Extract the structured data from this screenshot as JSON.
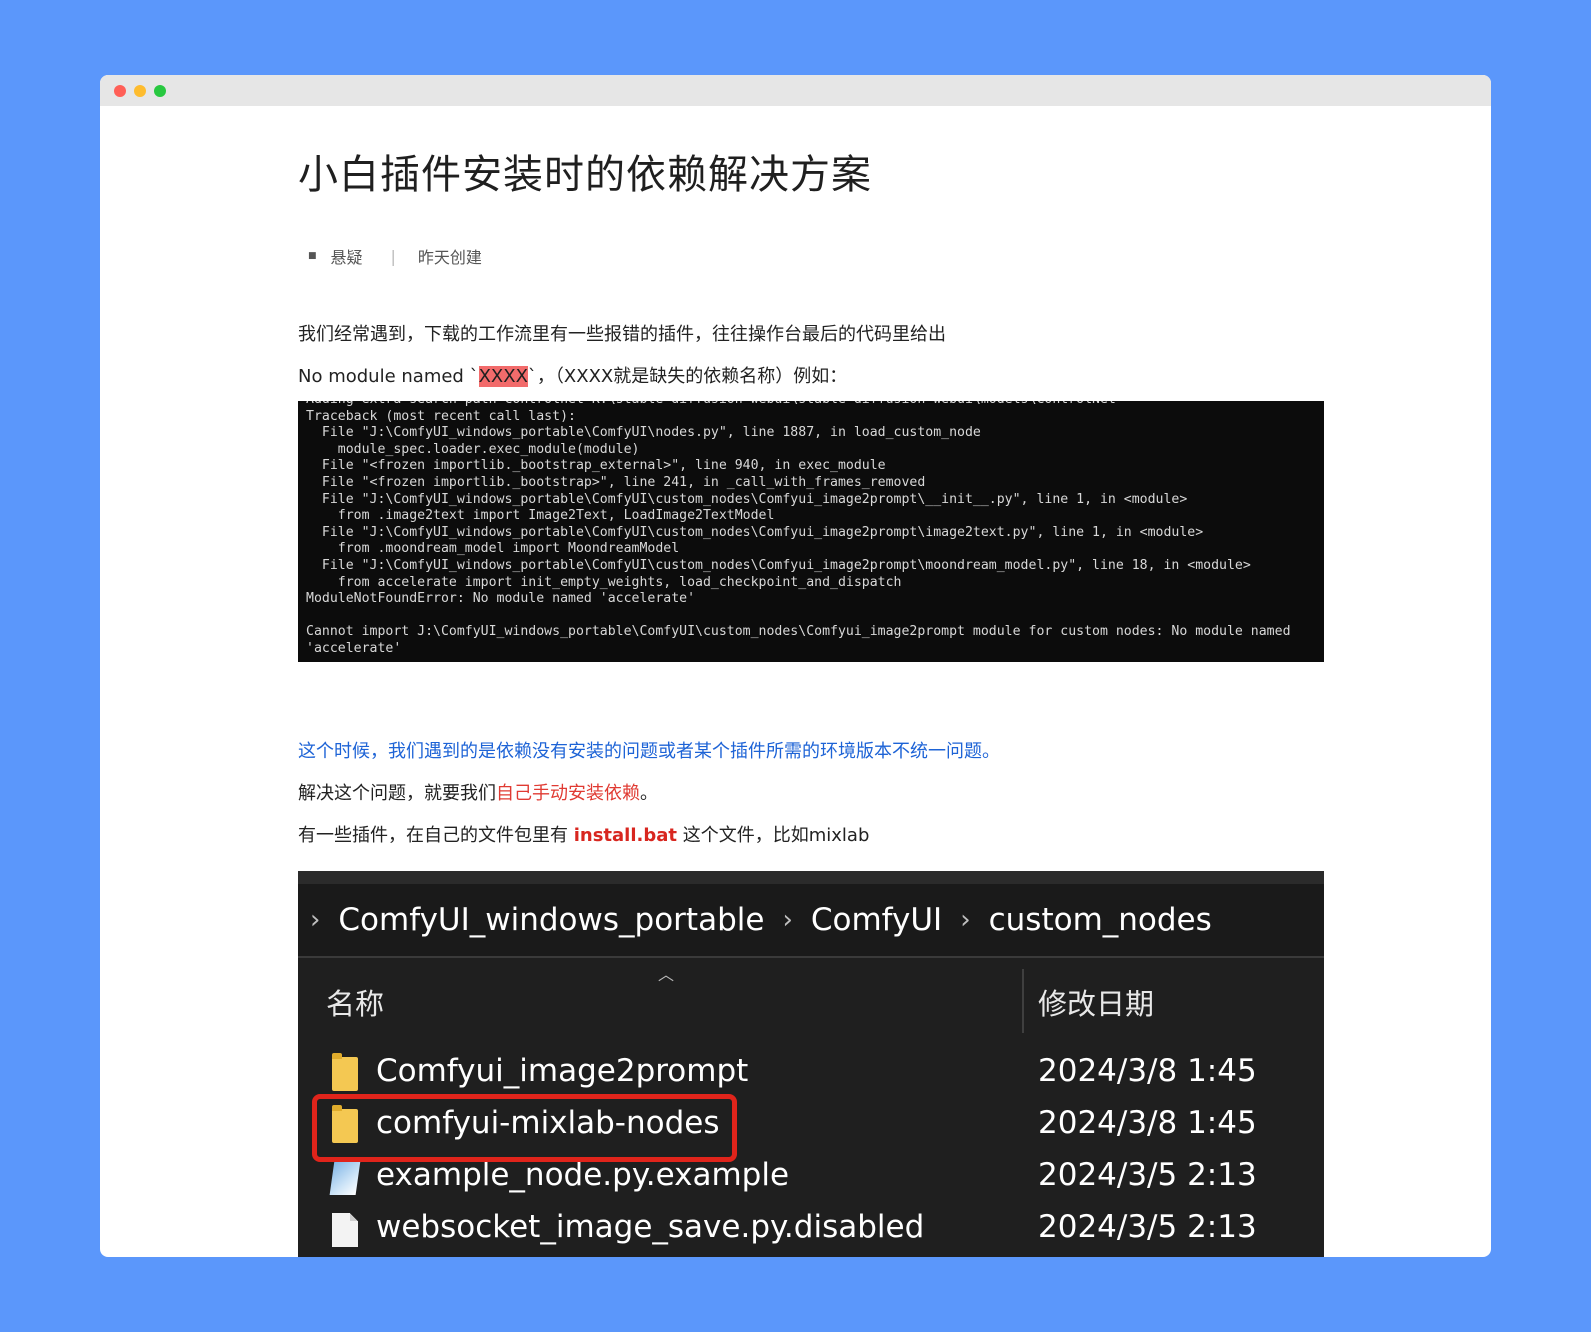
{
  "doc": {
    "title": "小白插件安装时的依赖解决方案",
    "meta": {
      "author": "悬疑",
      "created": "昨天创建"
    },
    "intro": "我们经常遇到，下载的工作流里有一些报错的插件，往往操作台最后的代码里给出",
    "module_line": {
      "prefix": "No module named `",
      "highlight": "XXXX",
      "suffix": "`，（XXXX就是缺失的依赖名称）例如："
    },
    "blue_line": "这个时候，我们遇到的是依赖没有安装的问题或者某个插件所需的环境版本不统一问题。",
    "solve_line": {
      "prefix": "解决这个问题，就要我们",
      "red": "自己手动安装依赖",
      "suffix": "。"
    },
    "install_line": {
      "prefix": "有一些插件，在自己的文件包里有 ",
      "bat": "install.bat",
      "suffix": " 这个文件，比如mixlab"
    }
  },
  "terminal": {
    "text": "Adding extra search path controlnet K:\\stable-diffusion-webui\\stable-diffusion-webui\\models\\ControlNet\nTraceback (most recent call last):\n  File \"J:\\ComfyUI_windows_portable\\ComfyUI\\nodes.py\", line 1887, in load_custom_node\n    module_spec.loader.exec_module(module)\n  File \"<frozen importlib._bootstrap_external>\", line 940, in exec_module\n  File \"<frozen importlib._bootstrap>\", line 241, in _call_with_frames_removed\n  File \"J:\\ComfyUI_windows_portable\\ComfyUI\\custom_nodes\\Comfyui_image2prompt\\__init__.py\", line 1, in <module>\n    from .image2text import Image2Text, LoadImage2TextModel\n  File \"J:\\ComfyUI_windows_portable\\ComfyUI\\custom_nodes\\Comfyui_image2prompt\\image2text.py\", line 1, in <module>\n    from .moondream_model import MoondreamModel\n  File \"J:\\ComfyUI_windows_portable\\ComfyUI\\custom_nodes\\Comfyui_image2prompt\\moondream_model.py\", line 18, in <module>\n    from accelerate import init_empty_weights, load_checkpoint_and_dispatch\nModuleNotFoundError: No module named 'accelerate'\n\nCannot import J:\\ComfyUI_windows_portable\\ComfyUI\\custom_nodes\\Comfyui_image2prompt module for custom nodes: No module named\n'accelerate'"
  },
  "explorer": {
    "breadcrumb": [
      "ComfyUI_windows_portable",
      "ComfyUI",
      "custom_nodes"
    ],
    "col_name": "名称",
    "col_date": "修改日期",
    "rows": [
      {
        "name": "Comfyui_image2prompt",
        "date": "2024/3/8 1:45",
        "icon": "folder-icon"
      },
      {
        "name": "comfyui-mixlab-nodes",
        "date": "2024/3/8 1:45",
        "icon": "folder-icon"
      },
      {
        "name": "example_node.py.example",
        "date": "2024/3/5 2:13",
        "icon": "python-file-icon"
      },
      {
        "name": "websocket_image_save.py.disabled",
        "date": "2024/3/5 2:13",
        "icon": "file-icon"
      }
    ]
  },
  "colors": {
    "background": "#5b97fb",
    "blue_text": "#1d63d6",
    "red_text": "#e03a32",
    "highlight_box": "#e0241b"
  }
}
